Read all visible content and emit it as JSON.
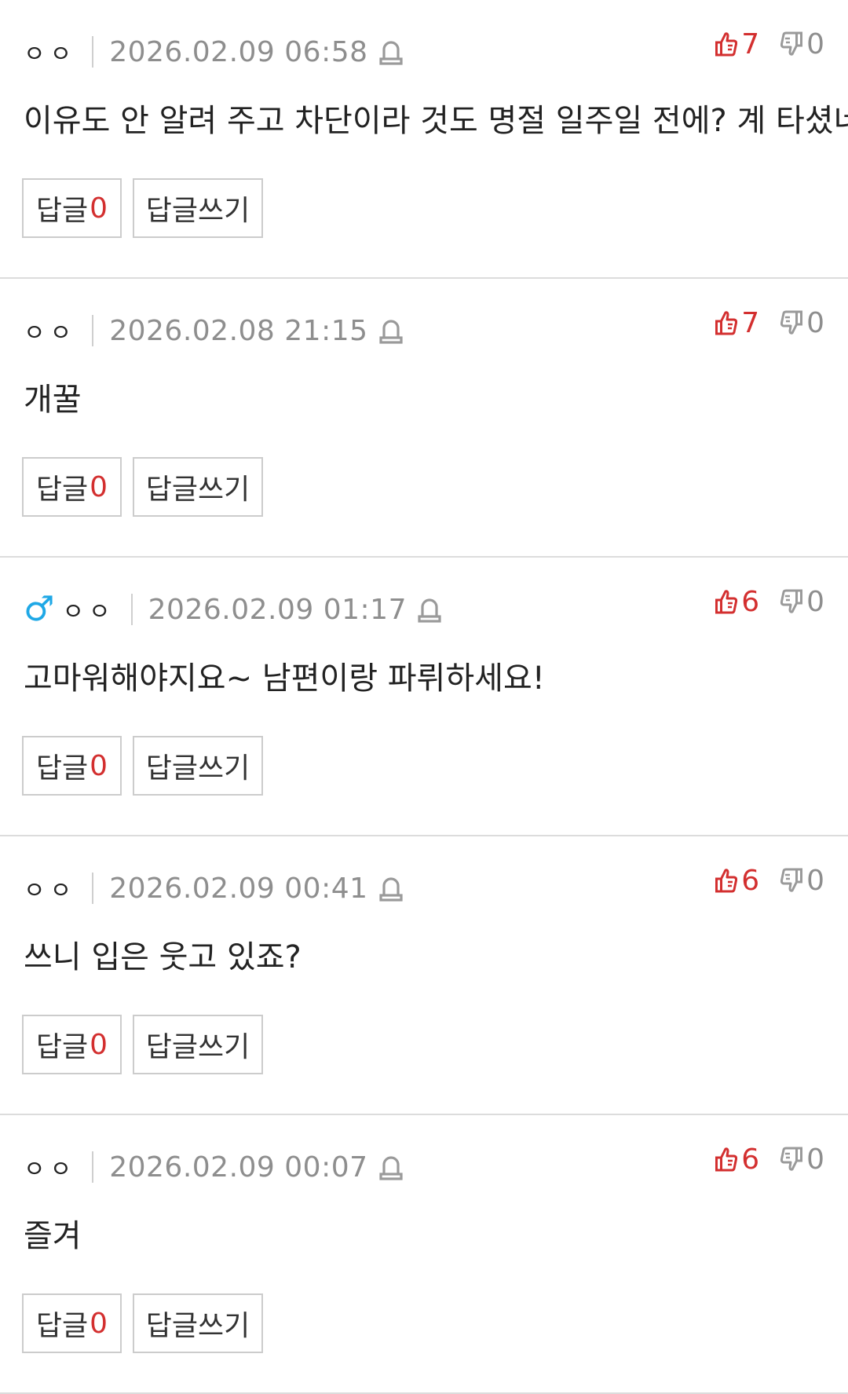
{
  "comments": [
    {
      "author": "ㅇㅇ",
      "gender_icon": "",
      "date": "2026.02.09 06:58",
      "likes": "7",
      "dislikes": "0",
      "text": "이유도 안 알려 주고 차단이라 것도 명절 일주일 전에? 계 타셨네",
      "reply_label": "답글",
      "reply_count": "0",
      "write_reply_label": "답글쓰기"
    },
    {
      "author": "ㅇㅇ",
      "gender_icon": "",
      "date": "2026.02.08 21:15",
      "likes": "7",
      "dislikes": "0",
      "text": "개꿀",
      "reply_label": "답글",
      "reply_count": "0",
      "write_reply_label": "답글쓰기"
    },
    {
      "author": "ㅇㅇ",
      "gender_icon": "♂",
      "date": "2026.02.09 01:17",
      "likes": "6",
      "dislikes": "0",
      "text": "고마워해야지요~ 남편이랑 파뤼하세요!",
      "reply_label": "답글",
      "reply_count": "0",
      "write_reply_label": "답글쓰기"
    },
    {
      "author": "ㅇㅇ",
      "gender_icon": "",
      "date": "2026.02.09 00:41",
      "likes": "6",
      "dislikes": "0",
      "text": "쓰니 입은 웃고 있죠?",
      "reply_label": "답글",
      "reply_count": "0",
      "write_reply_label": "답글쓰기"
    },
    {
      "author": "ㅇㅇ",
      "gender_icon": "",
      "date": "2026.02.09 00:07",
      "likes": "6",
      "dislikes": "0",
      "text": "즐겨",
      "reply_label": "답글",
      "reply_count": "0",
      "write_reply_label": "답글쓰기"
    }
  ],
  "icons": {
    "male": "male-icon",
    "report": "report-siren-icon",
    "like": "thumbs-up-icon",
    "dislike": "thumbs-down-icon"
  },
  "colors": {
    "like": "#d32f2f",
    "reply_count": "#d32f2f",
    "male": "#1fa8e6",
    "meta_gray": "#8e8e8e"
  }
}
